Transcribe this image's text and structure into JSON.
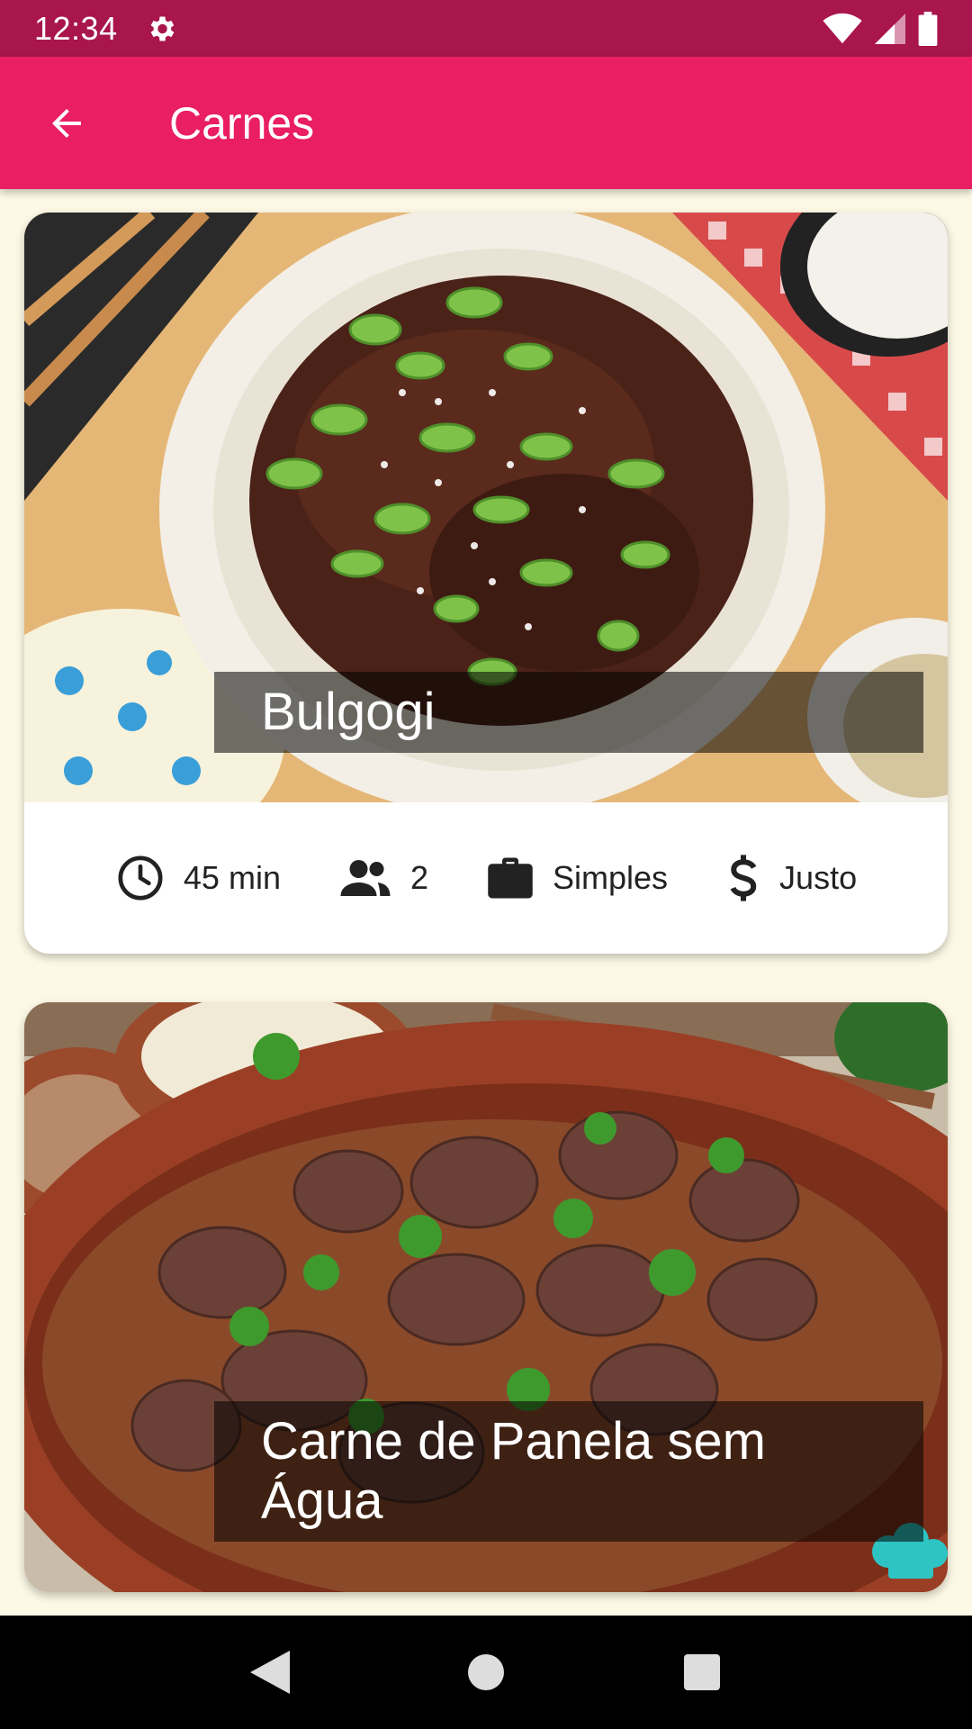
{
  "status_bar": {
    "time": "12:34"
  },
  "app_bar": {
    "title": "Carnes"
  },
  "recipes": [
    {
      "title": "Bulgogi",
      "time": "45 min",
      "servings": "2",
      "difficulty": "Simples",
      "cost": "Justo"
    },
    {
      "title": "Carne de Panela sem Água"
    }
  ],
  "colors": {
    "status_bar": "#a8164b",
    "app_bar": "#e91e63",
    "background": "#fdf9e6"
  }
}
